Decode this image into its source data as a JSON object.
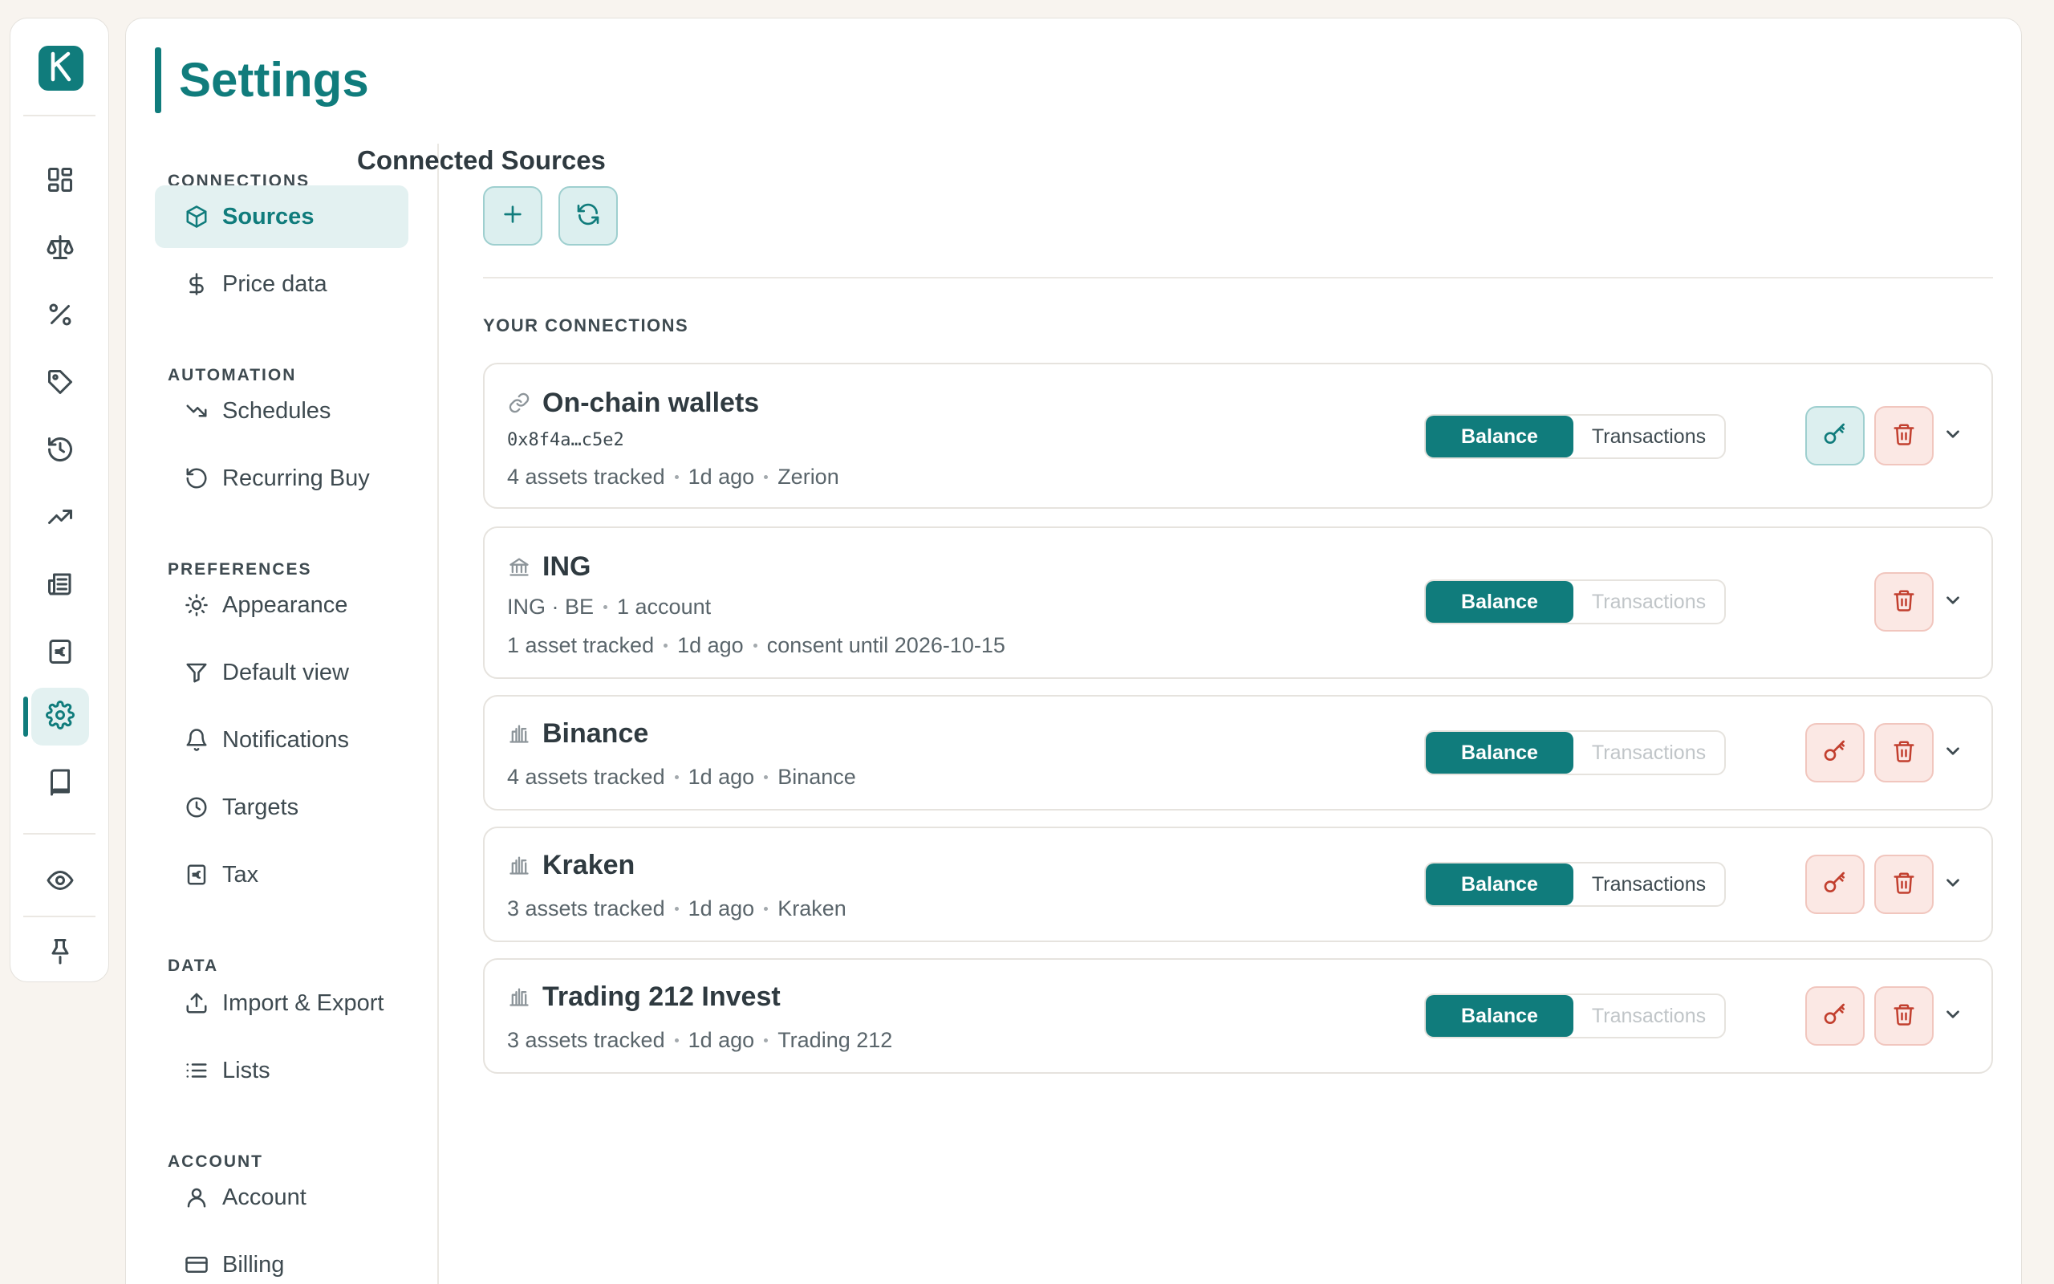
{
  "app": {
    "logo_letter": "K"
  },
  "rail": {
    "items": [
      {
        "icon": "dashboard-icon"
      },
      {
        "icon": "scale-icon"
      },
      {
        "icon": "percent-icon"
      },
      {
        "icon": "tag-icon"
      },
      {
        "icon": "history-icon"
      },
      {
        "icon": "trending-up-icon"
      },
      {
        "icon": "newspaper-icon"
      },
      {
        "icon": "euro-receipt-icon"
      },
      {
        "icon": "gear-icon",
        "active": true
      },
      {
        "icon": "book-icon"
      },
      {
        "icon": "eye-icon"
      },
      {
        "icon": "pin-icon"
      }
    ]
  },
  "page": {
    "title": "Settings"
  },
  "nav": {
    "sections": {
      "connections": "CONNECTIONS",
      "automation": "AUTOMATION",
      "preferences": "PREFERENCES",
      "data": "DATA",
      "account": "ACCOUNT"
    },
    "items": {
      "sources": "Sources",
      "price_data": "Price data",
      "schedules": "Schedules",
      "recurring_buy": "Recurring Buy",
      "appearance": "Appearance",
      "default_view": "Default view",
      "notifications": "Notifications",
      "targets": "Targets",
      "tax": "Tax",
      "import_export": "Import & Export",
      "lists": "Lists",
      "account": "Account",
      "billing": "Billing"
    }
  },
  "main": {
    "heading": "Connected Sources",
    "your_connections": "YOUR CONNECTIONS",
    "connections": [
      {
        "icon": "link-icon",
        "name": "On-chain wallets",
        "address": "0x8f4a…c5e2",
        "meta": [
          "4 assets tracked",
          "1d ago",
          "Zerion"
        ],
        "balance": "Balance",
        "transactions": "Transactions",
        "transactions_enabled": true,
        "key_style": "teal"
      },
      {
        "icon": "bank-icon",
        "name": "ING",
        "sub": [
          "ING · BE",
          "1 account"
        ],
        "meta": [
          "1 asset tracked",
          "1d ago",
          "consent until 2026-10-15"
        ],
        "balance": "Balance",
        "transactions": "Transactions",
        "transactions_enabled": false,
        "key_style": "none"
      },
      {
        "icon": "exchange-icon",
        "name": "Binance",
        "meta": [
          "4 assets tracked",
          "1d ago",
          "Binance"
        ],
        "balance": "Balance",
        "transactions": "Transactions",
        "transactions_enabled": false,
        "key_style": "red"
      },
      {
        "icon": "exchange-icon",
        "name": "Kraken",
        "meta": [
          "3 assets tracked",
          "1d ago",
          "Kraken"
        ],
        "balance": "Balance",
        "transactions": "Transactions",
        "transactions_enabled": true,
        "key_style": "red"
      },
      {
        "icon": "exchange-icon",
        "name": "Trading 212 Invest",
        "meta": [
          "3 assets tracked",
          "1d ago",
          "Trading 212"
        ],
        "balance": "Balance",
        "transactions": "Transactions",
        "transactions_enabled": false,
        "key_style": "red"
      }
    ]
  },
  "colors": {
    "accent": "#107c7c",
    "accent_soft": "#e3f1f1",
    "danger": "#c23f2e",
    "danger_soft": "#fbe8e4",
    "background": "#f8f4ef"
  }
}
